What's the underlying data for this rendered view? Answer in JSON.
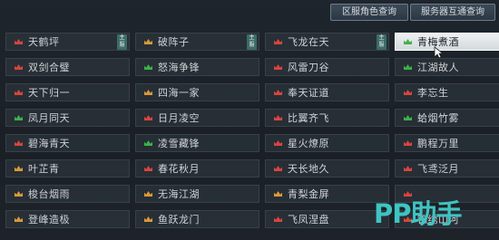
{
  "top_buttons": {
    "cross_server_query": "区服角色查询",
    "server_interconnect_query": "服务器互通查询"
  },
  "badge_text": "主服",
  "servers": [
    {
      "name": "天鹤坪",
      "flag": "red",
      "badge": true
    },
    {
      "name": "破阵子",
      "flag": "orange",
      "badge": true
    },
    {
      "name": "飞龙在天",
      "flag": "red",
      "badge": true
    },
    {
      "name": "青梅煮酒",
      "flag": "green",
      "badge": false,
      "selected": true
    },
    {
      "name": "双剑合璧",
      "flag": "red"
    },
    {
      "name": "怒海争锋",
      "flag": "green"
    },
    {
      "name": "风雷刀谷",
      "flag": "red"
    },
    {
      "name": "江湖故人",
      "flag": "green"
    },
    {
      "name": "天下归一",
      "flag": "red"
    },
    {
      "name": "四海一家",
      "flag": "orange"
    },
    {
      "name": "奉天证道",
      "flag": "red"
    },
    {
      "name": "李忘生",
      "flag": "red"
    },
    {
      "name": "凤月同天",
      "flag": "green"
    },
    {
      "name": "日月凌空",
      "flag": "red"
    },
    {
      "name": "比翼齐飞",
      "flag": "red"
    },
    {
      "name": "蛤烟竹雾",
      "flag": "green"
    },
    {
      "name": "碧海青天",
      "flag": "red"
    },
    {
      "name": "凌雪藏锋",
      "flag": "green"
    },
    {
      "name": "星火燎原",
      "flag": "red"
    },
    {
      "name": "鹏程万里",
      "flag": "red"
    },
    {
      "name": "叶芷青",
      "flag": "orange"
    },
    {
      "name": "春花秋月",
      "flag": "red"
    },
    {
      "name": "天长地久",
      "flag": "red"
    },
    {
      "name": "飞鸢泛月",
      "flag": "red"
    },
    {
      "name": "梭台烟雨",
      "flag": "orange"
    },
    {
      "name": "无海江湖",
      "flag": "orange"
    },
    {
      "name": "青梨金屏",
      "flag": "orange"
    },
    {
      "name": "",
      "flag": "red"
    },
    {
      "name": "登峰造极",
      "flag": "orange"
    },
    {
      "name": "鱼跃龙门",
      "flag": "orange"
    },
    {
      "name": "飞凤涅盘",
      "flag": "red"
    },
    {
      "name": "锦绣山河",
      "flag": "red"
    }
  ],
  "watermark": "PP助手",
  "colors": {
    "flag_red": "#d8453e",
    "flag_orange": "#d99a3a",
    "flag_green": "#3bb34a",
    "badge": "#3d6b67"
  }
}
